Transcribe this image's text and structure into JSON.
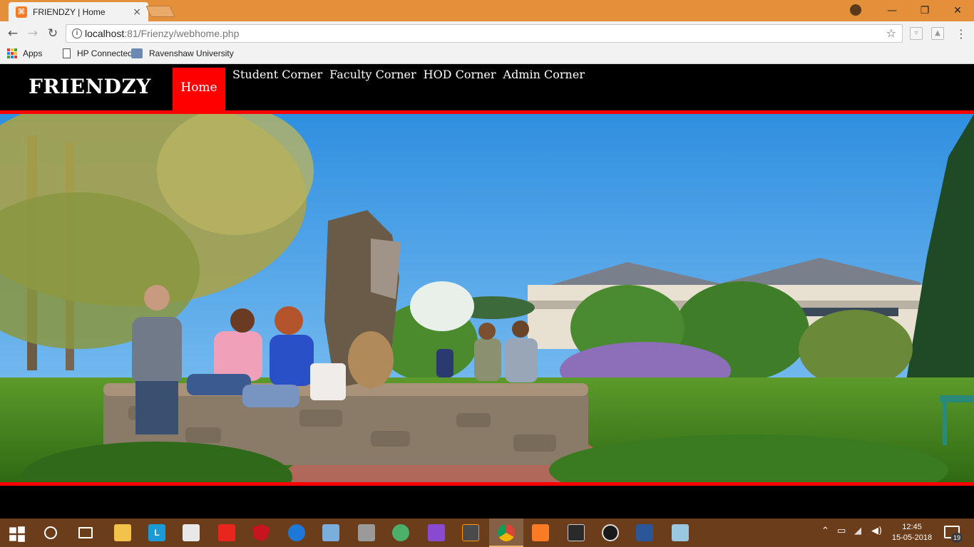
{
  "browser": {
    "tab_title": "FRIENDZY | Home",
    "tab_close": "×",
    "url_host": "localhost",
    "url_rest": ":81/Frienzy/webhome.php",
    "window_controls": [
      "—",
      "❐",
      "✕"
    ],
    "bookmarks": [
      {
        "label": "Apps",
        "icon": "apps-grid-icon"
      },
      {
        "label": "HP Connected",
        "icon": "page-icon"
      },
      {
        "label": "Ravenshaw University",
        "icon": "bookmark-site-icon"
      }
    ]
  },
  "site": {
    "brand": "FRIENDZY",
    "nav_active": "Home",
    "nav_links": [
      "Student Corner",
      "Faculty Corner",
      "HOD Corner",
      "Admin Corner"
    ],
    "accent_color": "#ff0000"
  },
  "taskbar": {
    "time": "12:45",
    "date": "15-05-2018",
    "notification_count": "19",
    "pinned_apps": [
      "windows-start-icon",
      "cortana-icon",
      "task-view-icon",
      "file-explorer-icon",
      "l-app-icon",
      "store-icon",
      "red-app-icon",
      "mcafee-icon",
      "edge-icon",
      "3d-box-icon",
      "tools-icon",
      "atom-icon",
      "visual-studio-icon",
      "sublime-icon",
      "chrome-icon",
      "xampp-icon",
      "terminal-icon",
      "speed-icon",
      "word-icon",
      "notes-icon"
    ]
  }
}
